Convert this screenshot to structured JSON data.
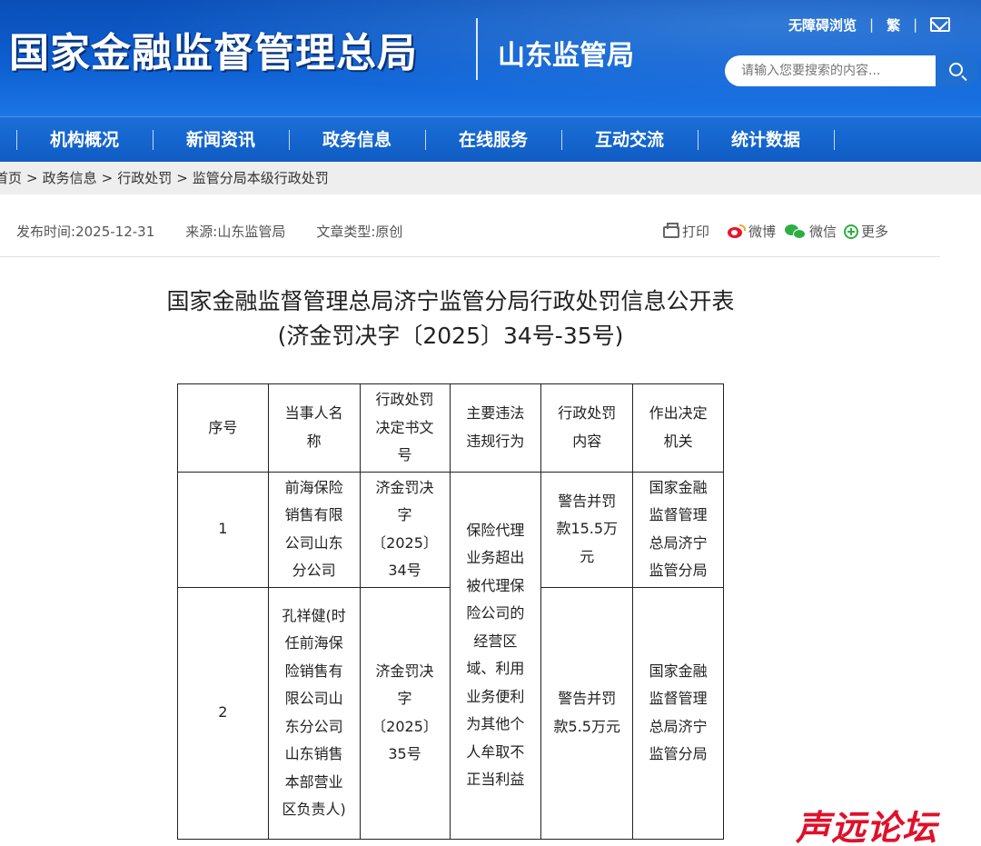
{
  "header": {
    "site_name": "国家金融监督管理总局",
    "branch_name": "山东监管局",
    "accessibility_link": "无障碍浏览",
    "traditional_link": "繁",
    "search_placeholder": "请输入您要搜索的内容..."
  },
  "nav": {
    "items": [
      "机构概况",
      "新闻资讯",
      "政务信息",
      "在线服务",
      "互动交流",
      "统计数据"
    ]
  },
  "breadcrumb": [
    "首页",
    "政务信息",
    "行政处罚",
    "监管分局本级行政处罚"
  ],
  "meta": {
    "publish_label": "发布时间:",
    "publish_date": "2025-12-31",
    "source_label": "来源:",
    "source": "山东监管局",
    "type_label": "文章类型:",
    "type": "原创"
  },
  "share": {
    "print": "打印",
    "weibo": "微博",
    "wechat": "微信",
    "more": "更多"
  },
  "article": {
    "title_line1": "国家金融监督管理总局济宁监管分局行政处罚信息公开表",
    "title_line2": "(济金罚决字〔2025〕34号-35号)"
  },
  "table": {
    "headers": [
      "序号",
      "当事人名称",
      "行政处罚决定书文号",
      "主要违法违规行为",
      "行政处罚内容",
      "作出决定机关"
    ],
    "violation": "保险代理业务超出被代理保险公司的经营区域、利用业务便利为其他个人牟取不正当利益",
    "rows": [
      {
        "no": "1",
        "party": "前海保险销售有限公司山东分公司",
        "doc_no": "济金罚决字〔2025〕34号",
        "penalty": "警告并罚款15.5万元",
        "authority": "国家金融监督管理总局济宁监管分局"
      },
      {
        "no": "2",
        "party": "孔祥健(时任前海保险销售有限公司山东分公司山东销售本部营业区负责人)",
        "doc_no": "济金罚决字〔2025〕35号",
        "penalty": "警告并罚款5.5万元",
        "authority": "国家金融监督管理总局济宁监管分局"
      }
    ]
  },
  "watermark": "声远论坛"
}
